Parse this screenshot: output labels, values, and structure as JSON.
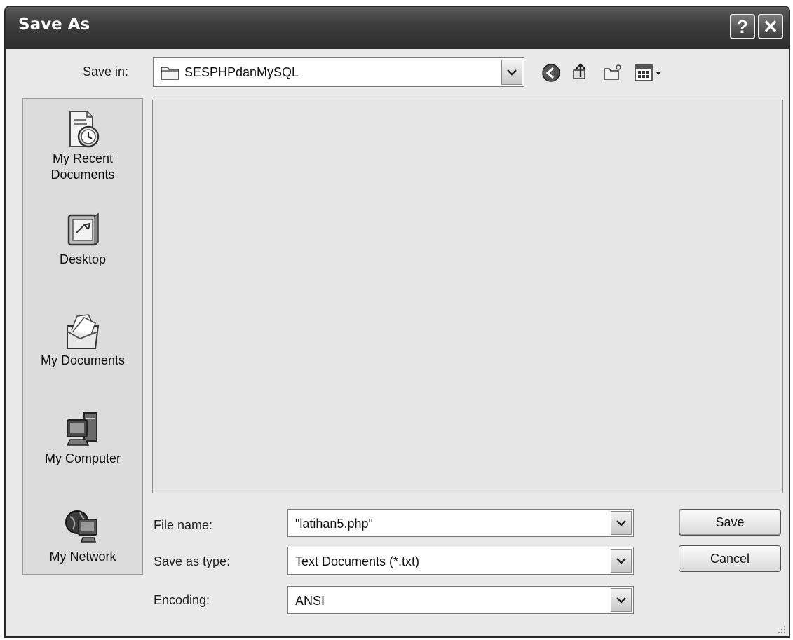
{
  "window": {
    "title": "Save As",
    "help_label": "?",
    "close_label": "✕"
  },
  "toolbar": {
    "save_in_label": "Save in:",
    "current_folder": "SESPHPdanMySQL",
    "icons": [
      "back-icon",
      "up-folder-icon",
      "new-folder-icon",
      "views-menu-icon"
    ]
  },
  "places": [
    {
      "label": "My Recent\nDocuments",
      "icon": "recent-documents-icon"
    },
    {
      "label": "Desktop",
      "icon": "desktop-icon"
    },
    {
      "label": "My Documents",
      "icon": "my-documents-icon"
    },
    {
      "label": "My Computer",
      "icon": "my-computer-icon"
    },
    {
      "label": "My Network",
      "icon": "my-network-icon"
    }
  ],
  "form": {
    "file_name_label": "File name:",
    "file_name_value": "\"latihan5.php\"",
    "save_as_type_label": "Save as type:",
    "save_as_type_value": "Text Documents (*.txt)",
    "encoding_label": "Encoding:",
    "encoding_value": "ANSI"
  },
  "buttons": {
    "save_label": "Save",
    "cancel_label": "Cancel"
  }
}
